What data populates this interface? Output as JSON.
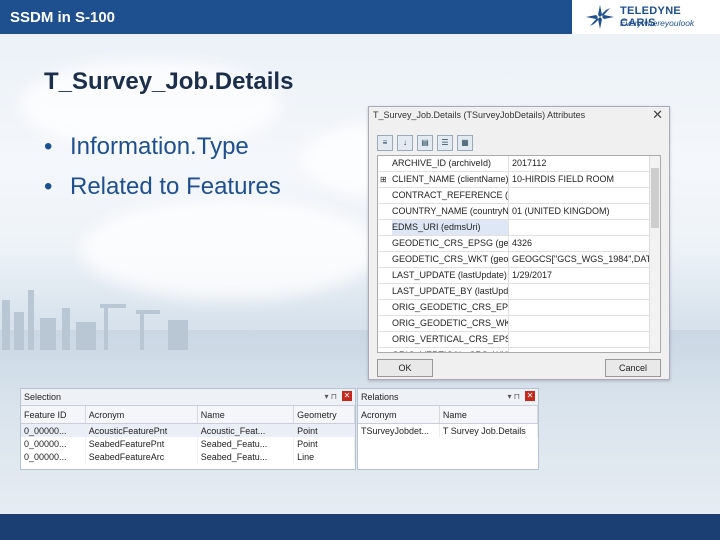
{
  "header": {
    "title": "SSDM in S-100"
  },
  "logo": {
    "brand": "TELEDYNE CARIS",
    "tagline": "Everywhereyoulook"
  },
  "slide": {
    "title": "T_Survey_Job.Details",
    "bullets": [
      "Information.Type",
      "Related to Features"
    ]
  },
  "attributes_window": {
    "title": "T_Survey_Job.Details (TSurveyJobDetails) Attributes",
    "rows": [
      {
        "expand": "",
        "prop": "ARCHIVE_ID (archiveId)",
        "val": "2017112"
      },
      {
        "expand": "⊞",
        "prop": "CLIENT_NAME (clientName)",
        "val": "10-HIRDIS FIELD ROOM"
      },
      {
        "expand": "",
        "prop": "CONTRACT_REFERENCE (cor",
        "val": ""
      },
      {
        "expand": "",
        "prop": "COUNTRY_NAME (countryNa",
        "val": "01 (UNITED KINGDOM)"
      },
      {
        "expand": "",
        "prop": "EDMS_URI (edmsUri)",
        "val": ""
      },
      {
        "expand": "",
        "prop": "GEODETIC_CRS_EPSG (geod",
        "val": "4326"
      },
      {
        "expand": "",
        "prop": "GEODETIC_CRS_WKT (geod",
        "val": "GEOGCS[\"GCS_WGS_1984\",DAT"
      },
      {
        "expand": "",
        "prop": "LAST_UPDATE (lastUpdate)",
        "val": "1/29/2017"
      },
      {
        "expand": "",
        "prop": "LAST_UPDATE_BY (lastUpda",
        "val": ""
      },
      {
        "expand": "",
        "prop": "ORIG_GEODETIC_CRS_EPSG",
        "val": ""
      },
      {
        "expand": "",
        "prop": "ORIG_GEODETIC_CRS_WKT",
        "val": ""
      },
      {
        "expand": "",
        "prop": "ORIG_VERTICAL_CRS_EPSG",
        "val": ""
      },
      {
        "expand": "",
        "prop": "ORIG_VERTICAL_CRS_WKT",
        "val": ""
      }
    ],
    "ok_label": "OK",
    "cancel_label": "Cancel"
  },
  "selection_panel": {
    "title": "Selection",
    "columns": [
      "Feature ID",
      "Acronym",
      "Name",
      "Geometry"
    ],
    "rows": [
      [
        "0_00000...",
        "AcousticFeaturePnt",
        "Acoustic_Feat...",
        "Point"
      ],
      [
        "0_00000...",
        "SeabedFeaturePnt",
        "Seabed_Featu...",
        "Point"
      ],
      [
        "0_00000...",
        "SeabedFeatureArc",
        "Seabed_Featu...",
        "Line"
      ]
    ]
  },
  "relations_panel": {
    "title": "Relations",
    "columns": [
      "Acronym",
      "Name"
    ],
    "rows": [
      [
        "TSurveyJobdet...",
        "T Survey Job.Details"
      ]
    ]
  }
}
